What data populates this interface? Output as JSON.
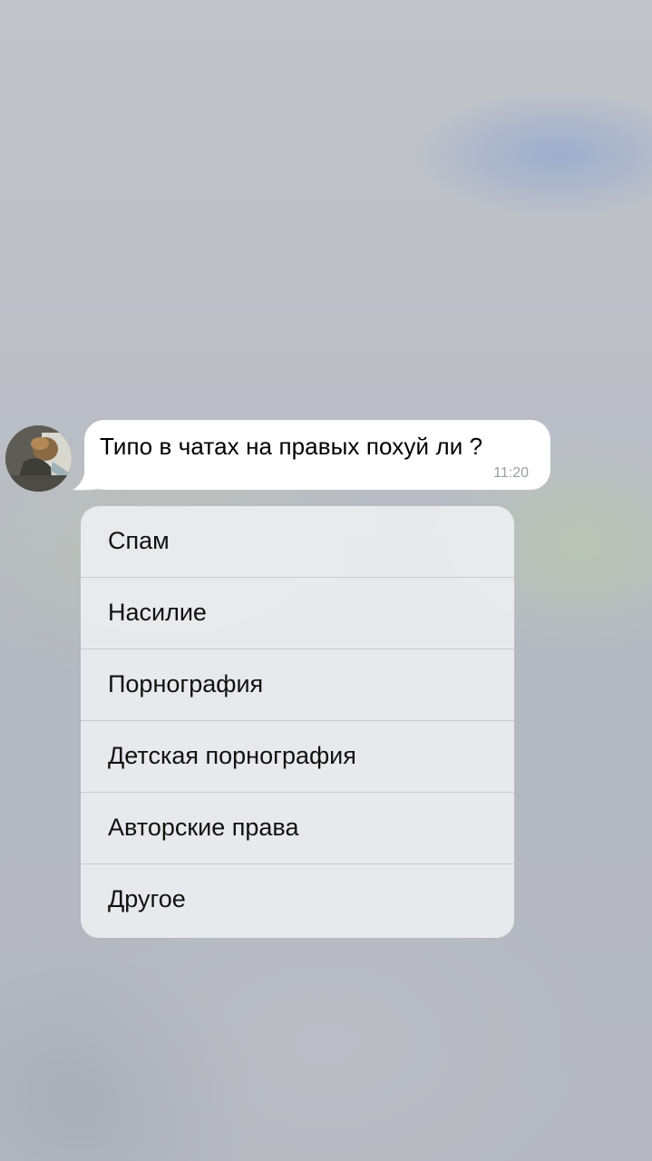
{
  "message": {
    "text": "Типо в чатах на правых похуй ли ?",
    "time": "11:20"
  },
  "report_menu": {
    "items": [
      {
        "label": "Спам"
      },
      {
        "label": "Насилие"
      },
      {
        "label": "Порнография"
      },
      {
        "label": "Детская порнография"
      },
      {
        "label": "Авторские права"
      },
      {
        "label": "Другое"
      }
    ]
  }
}
